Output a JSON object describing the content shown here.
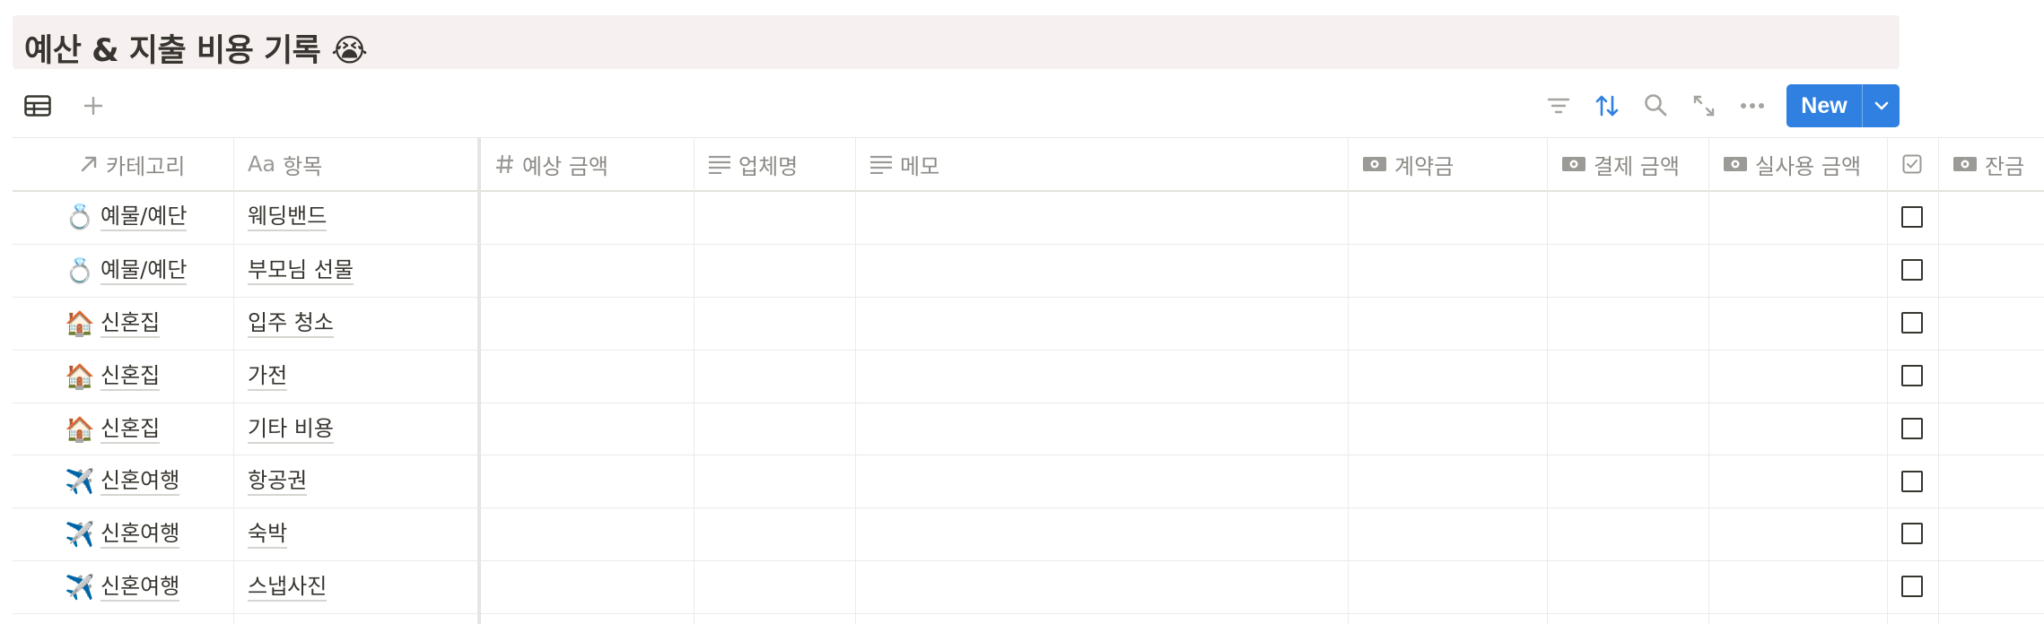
{
  "page": {
    "title": "예산 & 지출 비용 기록",
    "title_emoji": "😭"
  },
  "view": {
    "icon": "table-view-icon",
    "add_icon": "plus-icon"
  },
  "toolbar": {
    "icons": [
      "filter-icon",
      "sort-icon",
      "search-icon",
      "expand-icon",
      "more-icon"
    ],
    "new_label": "New",
    "accent_color": "#2f80e0",
    "sort_active_color": "#2f80e0"
  },
  "table": {
    "columns": [
      {
        "label": "카테고리",
        "icon": "relation-arrow-icon"
      },
      {
        "label": "항목",
        "icon": "title-aa-icon",
        "icon_text": "Aa"
      },
      {
        "label": "예상 금액",
        "icon": "number-hash-icon"
      },
      {
        "label": "업체명",
        "icon": "text-lines-icon"
      },
      {
        "label": "메모",
        "icon": "text-lines-icon"
      },
      {
        "label": "계약금",
        "icon": "money-icon"
      },
      {
        "label": "결제 금액",
        "icon": "money-icon"
      },
      {
        "label": "실사용 금액",
        "icon": "money-icon"
      },
      {
        "label": "",
        "icon": "checkbox-icon"
      },
      {
        "label": "잔금",
        "icon": "money-icon"
      }
    ],
    "rows": [
      {
        "category": "예물/예단",
        "emoji": "💍",
        "item": "웨딩밴드",
        "checked": false
      },
      {
        "category": "예물/예단",
        "emoji": "💍",
        "item": "부모님 선물",
        "checked": false
      },
      {
        "category": "신혼집",
        "emoji": "🏠",
        "item": "입주 청소",
        "checked": false
      },
      {
        "category": "신혼집",
        "emoji": "🏠",
        "item": "가전",
        "checked": false
      },
      {
        "category": "신혼집",
        "emoji": "🏠",
        "item": "기타 비용",
        "checked": false
      },
      {
        "category": "신혼여행",
        "emoji": "✈️",
        "item": "항공권",
        "checked": false
      },
      {
        "category": "신혼여행",
        "emoji": "✈️",
        "item": "숙박",
        "checked": false
      },
      {
        "category": "신혼여행",
        "emoji": "✈️",
        "item": "스냅사진",
        "checked": false
      }
    ]
  }
}
